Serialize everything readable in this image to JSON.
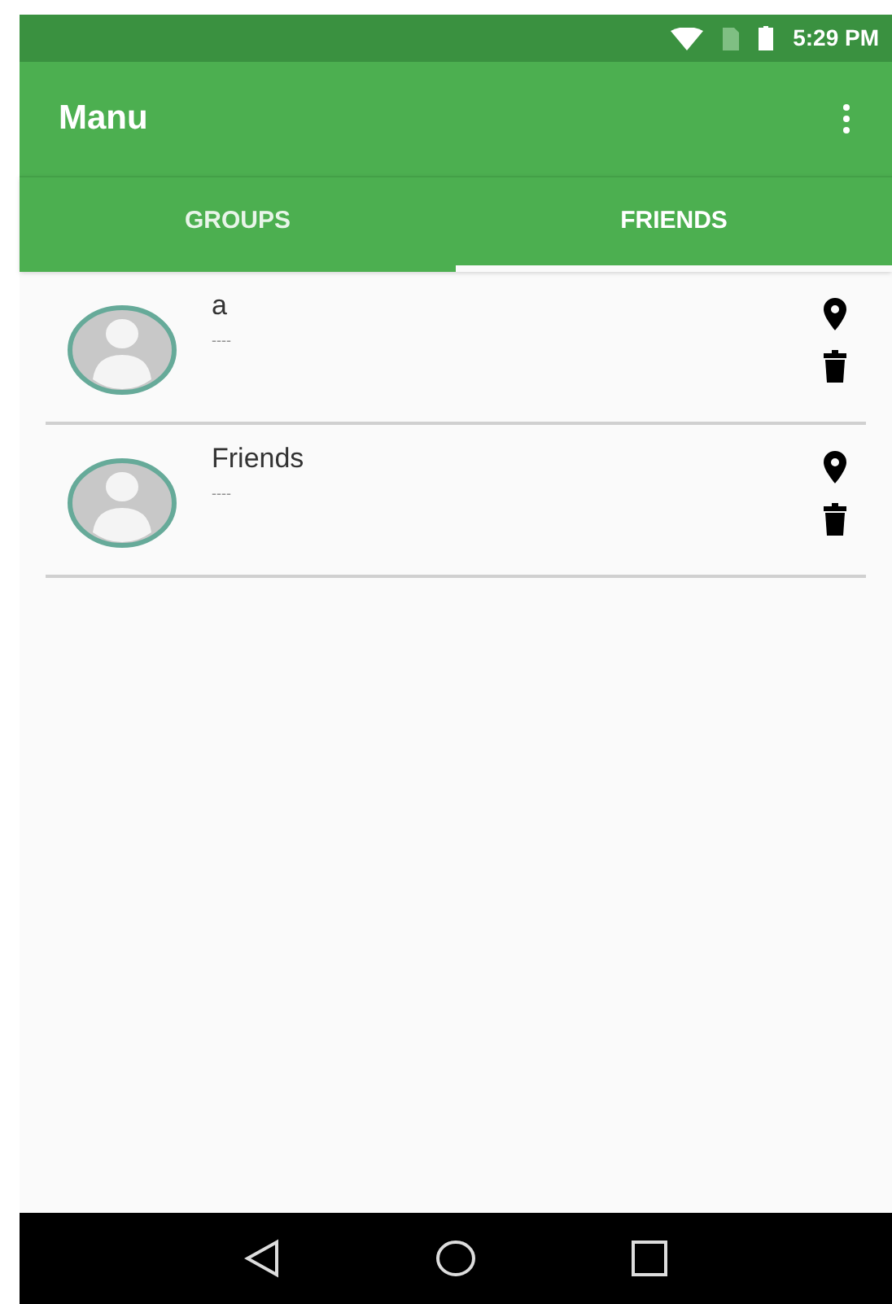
{
  "status_bar": {
    "time": "5:29 PM"
  },
  "toolbar": {
    "title": "Manu"
  },
  "tabs": [
    {
      "label": "GROUPS",
      "selected": false
    },
    {
      "label": "FRIENDS",
      "selected": true
    }
  ],
  "list": [
    {
      "name": "a",
      "subtitle": "----"
    },
    {
      "name": "Friends",
      "subtitle": "----"
    }
  ]
}
